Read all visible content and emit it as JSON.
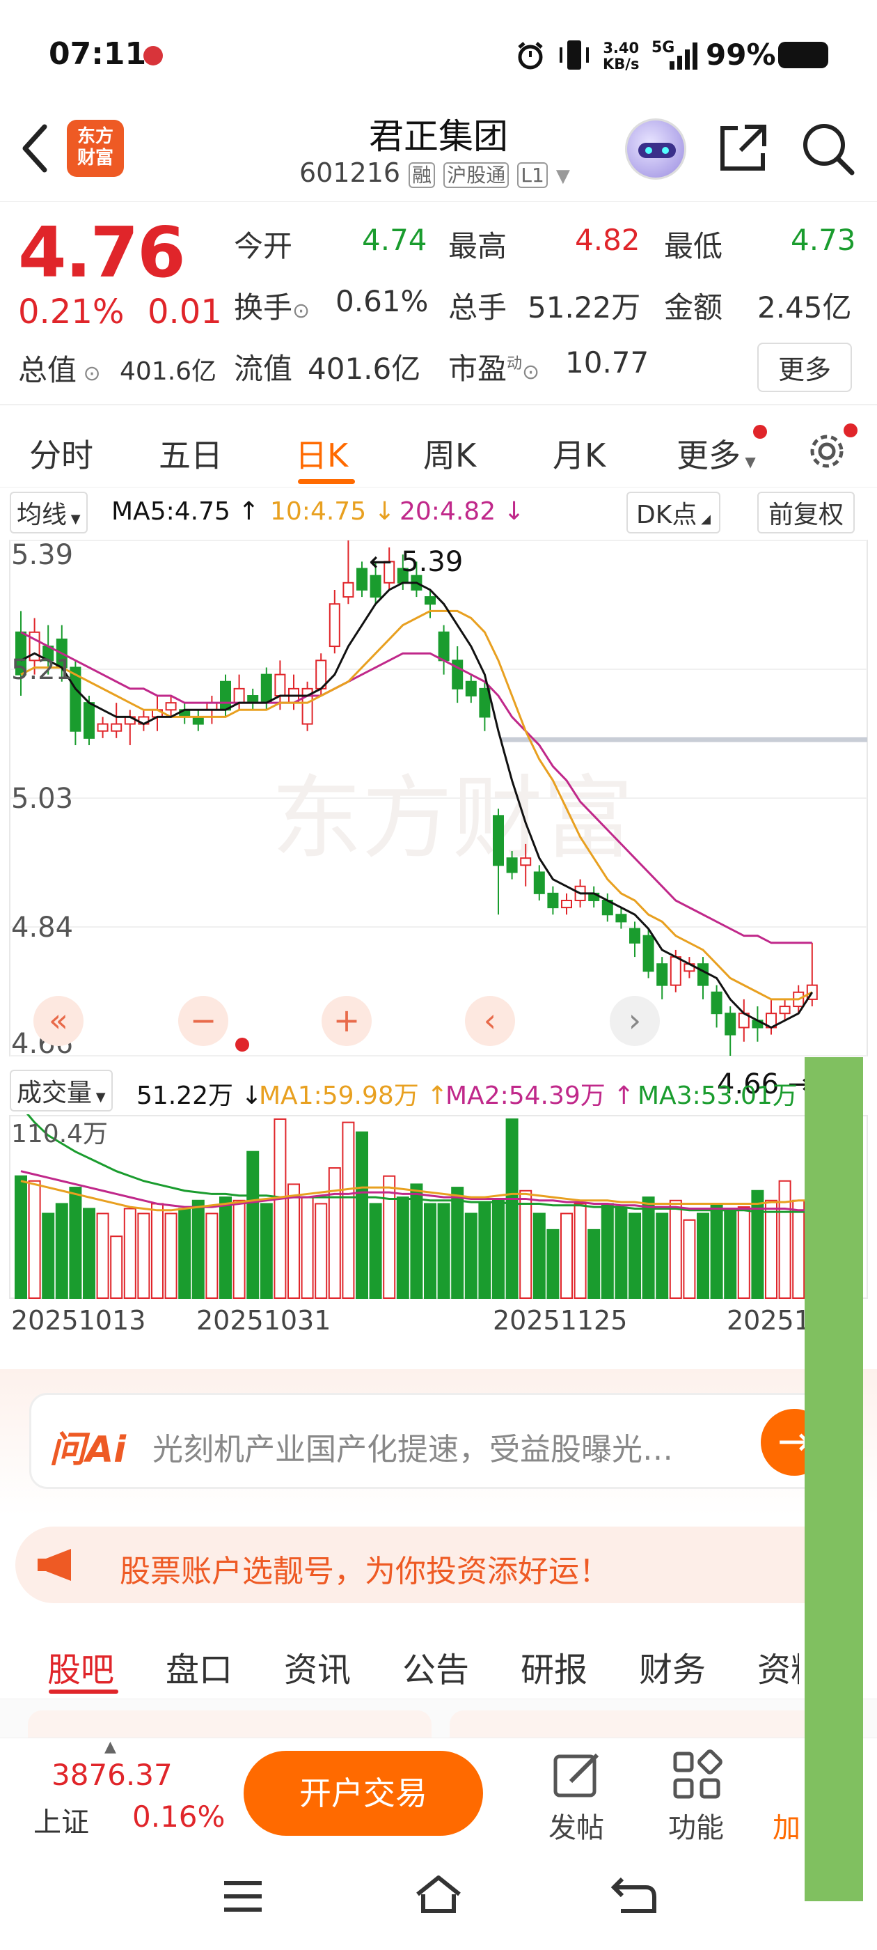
{
  "status_bar": {
    "time": "07:11",
    "net_speed_top": "3.40",
    "net_speed_bottom": "KB/s",
    "network": "5G",
    "battery": "99%"
  },
  "header": {
    "app_logo_line1": "东方",
    "app_logo_line2": "财富",
    "title": "君正集团",
    "code": "601216",
    "tag_margin": "融",
    "tag_connect": "沪股通",
    "tag_level": "L1"
  },
  "quote": {
    "price": "4.76",
    "change_pct": "0.21%",
    "change": "0.01",
    "open_label": "今开",
    "open": "4.74",
    "high_label": "最高",
    "high": "4.82",
    "low_label": "最低",
    "low": "4.73",
    "turnover_label": "换手",
    "turnover": "0.61%",
    "volume_label": "总手",
    "volume": "51.22万",
    "amount_label": "金额",
    "amount": "2.45亿",
    "mcap_label": "总值",
    "mcap": "401.6亿",
    "float_label": "流值",
    "float": "401.6亿",
    "pe_label": "市盈",
    "pe_sup": "动",
    "pe": "10.77",
    "more": "更多"
  },
  "tabs": [
    "分时",
    "五日",
    "日K",
    "周K",
    "月K",
    "更多"
  ],
  "kline": {
    "ma_selector": "均线",
    "ma5": "MA5:4.75 ↑",
    "ma10": "10:4.75 ↓",
    "ma20": "20:4.82 ↓",
    "dk_button": "DK点",
    "adjust_button": "前复权",
    "y_ticks": [
      "5.39",
      "5.21",
      "5.03",
      "4.84",
      "4.66"
    ],
    "max_marker": "← 5.39",
    "min_marker": "4.66 →",
    "watermark": "东方财富"
  },
  "volume_panel": {
    "selector": "成交量",
    "value": "51.22万 ↓",
    "ma1": "MA1:59.98万 ↑",
    "ma2": "MA2:54.39万 ↑",
    "ma3": "MA3:53.01万 ↓",
    "max_label": "110.4万",
    "dates": [
      "20251013",
      "20251031",
      "20251125",
      "20251"
    ]
  },
  "ai_box": {
    "logo": "问Ai",
    "placeholder": "光刻机产业国产化提速，受益股曝光…"
  },
  "banner": {
    "text": "股票账户选靓号，为你投资添好运！"
  },
  "sub_tabs": [
    "股吧",
    "盘口",
    "资讯",
    "公告",
    "研报",
    "财务",
    "资料"
  ],
  "bottom_bar": {
    "index_value": "3876.37",
    "index_name": "上证",
    "index_change": "0.16%",
    "trade_button": "开户交易",
    "post_label": "发帖",
    "func_label": "功能",
    "add_label": "加"
  },
  "colors": {
    "up": "#e0252a",
    "down": "#1a9c2e",
    "accent": "#ff6a00",
    "ma5": "#111111",
    "ma10": "#e8a020",
    "ma20": "#c0288a"
  },
  "chart_data": {
    "type": "candlestick",
    "ylim": [
      4.66,
      5.39
    ],
    "candles": [
      [
        5.26,
        5.2,
        5.29,
        5.17
      ],
      [
        5.22,
        5.26,
        5.28,
        5.2
      ],
      [
        5.24,
        5.22,
        5.27,
        5.2
      ],
      [
        5.25,
        5.21,
        5.27,
        5.19
      ],
      [
        5.21,
        5.12,
        5.22,
        5.1
      ],
      [
        5.16,
        5.11,
        5.17,
        5.1
      ],
      [
        5.12,
        5.13,
        5.14,
        5.11
      ],
      [
        5.12,
        5.13,
        5.16,
        5.11
      ],
      [
        5.13,
        5.14,
        5.15,
        5.1
      ],
      [
        5.13,
        5.14,
        5.15,
        5.12
      ],
      [
        5.14,
        5.15,
        5.17,
        5.12
      ],
      [
        5.15,
        5.16,
        5.17,
        5.14
      ],
      [
        5.15,
        5.14,
        5.16,
        5.13
      ],
      [
        5.14,
        5.13,
        5.15,
        5.12
      ],
      [
        5.15,
        5.16,
        5.17,
        5.13
      ],
      [
        5.19,
        5.15,
        5.2,
        5.14
      ],
      [
        5.16,
        5.18,
        5.2,
        5.15
      ],
      [
        5.17,
        5.16,
        5.18,
        5.15
      ],
      [
        5.2,
        5.16,
        5.21,
        5.15
      ],
      [
        5.17,
        5.2,
        5.22,
        5.15
      ],
      [
        5.16,
        5.18,
        5.2,
        5.15
      ],
      [
        5.13,
        5.18,
        5.19,
        5.12
      ],
      [
        5.18,
        5.22,
        5.23,
        5.17
      ],
      [
        5.24,
        5.3,
        5.32,
        5.23
      ],
      [
        5.31,
        5.33,
        5.39,
        5.3
      ],
      [
        5.35,
        5.32,
        5.36,
        5.31
      ],
      [
        5.34,
        5.31,
        5.36,
        5.3
      ],
      [
        5.33,
        5.36,
        5.38,
        5.32
      ],
      [
        5.35,
        5.33,
        5.37,
        5.32
      ],
      [
        5.34,
        5.32,
        5.36,
        5.31
      ],
      [
        5.31,
        5.3,
        5.32,
        5.28
      ],
      [
        5.26,
        5.22,
        5.27,
        5.2
      ],
      [
        5.22,
        5.18,
        5.24,
        5.16
      ],
      [
        5.19,
        5.17,
        5.2,
        5.16
      ],
      [
        5.18,
        5.14,
        5.19,
        5.12
      ],
      [
        5.0,
        4.93,
        5.01,
        4.86
      ],
      [
        4.94,
        4.92,
        4.95,
        4.91
      ],
      [
        4.93,
        4.94,
        4.96,
        4.9
      ],
      [
        4.92,
        4.89,
        4.93,
        4.88
      ],
      [
        4.89,
        4.87,
        4.9,
        4.86
      ],
      [
        4.87,
        4.88,
        4.89,
        4.86
      ],
      [
        4.88,
        4.9,
        4.91,
        4.87
      ],
      [
        4.89,
        4.88,
        4.9,
        4.87
      ],
      [
        4.88,
        4.86,
        4.89,
        4.85
      ],
      [
        4.86,
        4.85,
        4.87,
        4.84
      ],
      [
        4.84,
        4.82,
        4.85,
        4.8
      ],
      [
        4.83,
        4.78,
        4.84,
        4.77
      ],
      [
        4.79,
        4.76,
        4.8,
        4.74
      ],
      [
        4.76,
        4.8,
        4.81,
        4.75
      ],
      [
        4.78,
        4.79,
        4.8,
        4.77
      ],
      [
        4.79,
        4.76,
        4.8,
        4.74
      ],
      [
        4.75,
        4.72,
        4.76,
        4.7
      ],
      [
        4.72,
        4.69,
        4.73,
        4.66
      ],
      [
        4.7,
        4.72,
        4.74,
        4.68
      ],
      [
        4.71,
        4.7,
        4.73,
        4.68
      ],
      [
        4.7,
        4.72,
        4.74,
        4.69
      ],
      [
        4.72,
        4.73,
        4.74,
        4.71
      ],
      [
        4.73,
        4.75,
        4.76,
        4.72
      ],
      [
        4.74,
        4.76,
        4.82,
        4.73
      ]
    ],
    "ma5": [
      5.22,
      5.23,
      5.22,
      5.21,
      5.18,
      5.16,
      5.15,
      5.14,
      5.14,
      5.13,
      5.14,
      5.14,
      5.15,
      5.15,
      5.15,
      5.15,
      5.16,
      5.16,
      5.16,
      5.17,
      5.17,
      5.17,
      5.18,
      5.2,
      5.24,
      5.27,
      5.3,
      5.32,
      5.33,
      5.33,
      5.32,
      5.3,
      5.27,
      5.24,
      5.2,
      5.12,
      5.05,
      4.99,
      4.94,
      4.91,
      4.9,
      4.89,
      4.89,
      4.88,
      4.87,
      4.86,
      4.84,
      4.81,
      4.8,
      4.79,
      4.78,
      4.77,
      4.74,
      4.72,
      4.71,
      4.7,
      4.71,
      4.72,
      4.75
    ],
    "ma10": [
      5.2,
      5.21,
      5.21,
      5.21,
      5.2,
      5.19,
      5.18,
      5.17,
      5.16,
      5.15,
      5.15,
      5.14,
      5.14,
      5.14,
      5.14,
      5.14,
      5.15,
      5.15,
      5.15,
      5.16,
      5.16,
      5.16,
      5.17,
      5.18,
      5.19,
      5.21,
      5.23,
      5.25,
      5.27,
      5.28,
      5.29,
      5.29,
      5.29,
      5.28,
      5.26,
      5.22,
      5.17,
      5.12,
      5.08,
      5.05,
      5.01,
      4.97,
      4.94,
      4.91,
      4.89,
      4.88,
      4.86,
      4.85,
      4.83,
      4.82,
      4.81,
      4.79,
      4.77,
      4.76,
      4.75,
      4.74,
      4.74,
      4.74,
      4.75
    ],
    "ma20": [
      5.26,
      5.25,
      5.24,
      5.23,
      5.22,
      5.21,
      5.2,
      5.19,
      5.18,
      5.18,
      5.17,
      5.17,
      5.16,
      5.16,
      5.16,
      5.16,
      5.16,
      5.16,
      5.16,
      5.16,
      5.16,
      5.17,
      5.17,
      5.18,
      5.19,
      5.2,
      5.21,
      5.22,
      5.23,
      5.23,
      5.23,
      5.22,
      5.21,
      5.2,
      5.19,
      5.17,
      5.14,
      5.12,
      5.1,
      5.07,
      5.05,
      5.02,
      5.0,
      4.98,
      4.96,
      4.94,
      4.92,
      4.9,
      4.88,
      4.87,
      4.86,
      4.85,
      4.84,
      4.83,
      4.83,
      4.82,
      4.82,
      4.82,
      4.82
    ],
    "volume_ylim": [
      0,
      110.4
    ],
    "volumes": [
      75,
      72,
      52,
      58,
      68,
      55,
      52,
      38,
      55,
      52,
      58,
      52,
      55,
      60,
      52,
      62,
      60,
      90,
      58,
      110,
      70,
      62,
      58,
      80,
      108,
      102,
      58,
      75,
      62,
      70,
      58,
      58,
      68,
      52,
      58,
      60,
      110,
      66,
      52,
      42,
      52,
      58,
      42,
      58,
      55,
      52,
      62,
      52,
      60,
      48,
      52,
      58,
      55,
      56,
      66,
      60,
      72,
      60,
      62
    ],
    "vol_ma1": [
      72,
      70,
      68,
      66,
      64,
      62,
      60,
      58,
      56,
      55,
      54,
      54,
      55,
      56,
      57,
      58,
      59,
      60,
      61,
      62,
      63,
      64,
      65,
      66,
      67,
      68,
      68,
      68,
      67,
      66,
      65,
      64,
      63,
      62,
      62,
      63,
      64,
      64,
      63,
      62,
      61,
      60,
      60,
      60,
      59,
      59,
      58,
      58,
      58,
      58,
      58,
      58,
      58,
      58,
      58,
      59,
      59,
      60,
      60
    ],
    "vol_ma2": [
      78,
      76,
      74,
      72,
      70,
      68,
      66,
      64,
      62,
      60,
      58,
      57,
      56,
      56,
      56,
      57,
      58,
      59,
      60,
      61,
      62,
      62,
      63,
      64,
      64,
      65,
      65,
      65,
      64,
      64,
      63,
      62,
      62,
      61,
      61,
      61,
      61,
      61,
      60,
      60,
      59,
      59,
      58,
      58,
      57,
      57,
      56,
      56,
      56,
      55,
      55,
      55,
      55,
      55,
      55,
      55,
      55,
      54,
      54
    ],
    "vol_ma3": [
      118,
      108,
      100,
      95,
      90,
      86,
      82,
      78,
      75,
      72,
      70,
      68,
      66,
      65,
      64,
      64,
      63,
      63,
      63,
      62,
      62,
      62,
      62,
      62,
      62,
      62,
      62,
      61,
      61,
      61,
      60,
      60,
      60,
      59,
      59,
      59,
      58,
      58,
      58,
      57,
      57,
      57,
      56,
      56,
      56,
      55,
      55,
      55,
      55,
      54,
      54,
      54,
      54,
      54,
      53,
      53,
      53,
      53,
      53
    ]
  }
}
